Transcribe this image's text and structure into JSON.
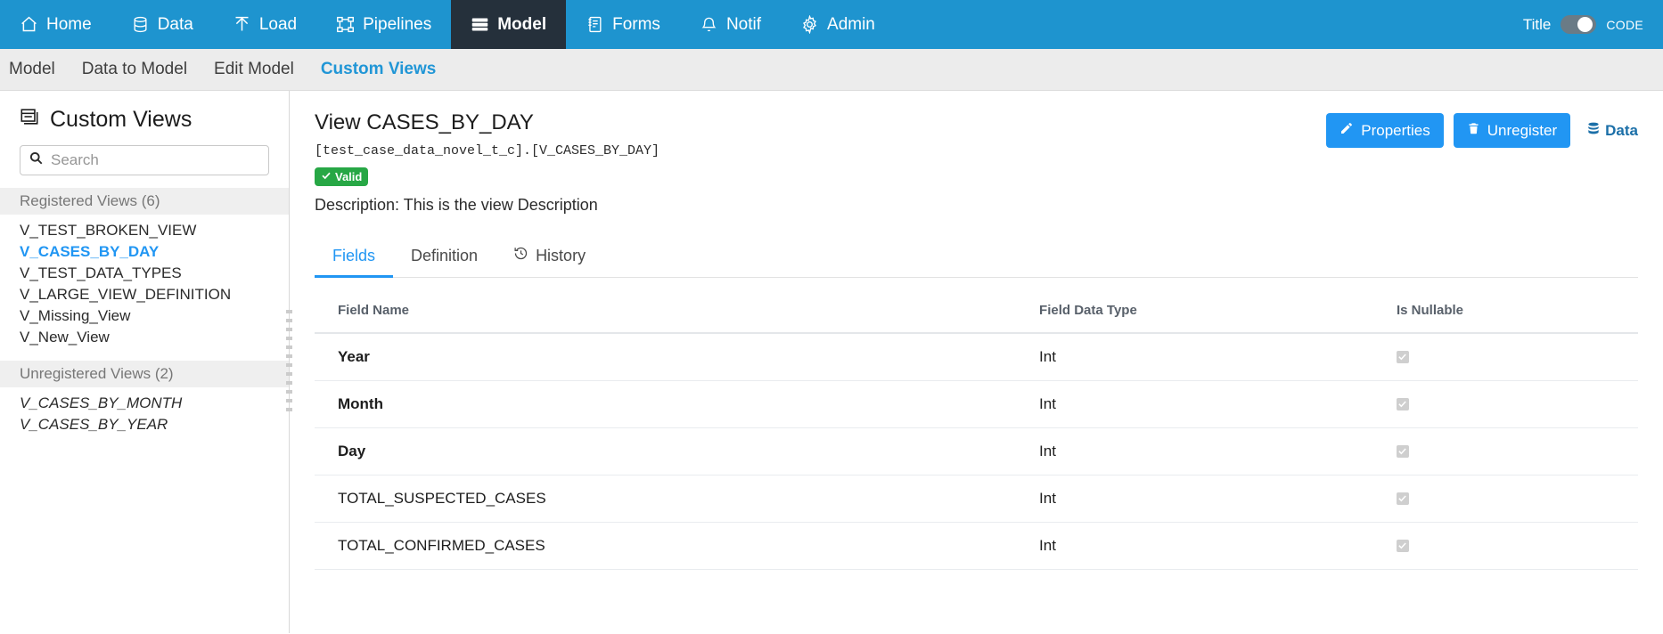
{
  "navbar": {
    "items": [
      {
        "label": "Home",
        "icon": "home-icon",
        "active": false
      },
      {
        "label": "Data",
        "icon": "database-icon",
        "active": false
      },
      {
        "label": "Load",
        "icon": "upload-icon",
        "active": false
      },
      {
        "label": "Pipelines",
        "icon": "pipeline-icon",
        "active": false
      },
      {
        "label": "Model",
        "icon": "server-icon",
        "active": true
      },
      {
        "label": "Forms",
        "icon": "form-icon",
        "active": false
      },
      {
        "label": "Notif",
        "icon": "bell-icon",
        "active": false
      },
      {
        "label": "Admin",
        "icon": "gear-icon",
        "active": false
      }
    ],
    "toggle": {
      "left_label": "Title",
      "right_label": "CODE",
      "state": "right"
    },
    "background_color": "#1e94cf",
    "active_color": "#25303b"
  },
  "breadcrumb": {
    "items": [
      {
        "label": "Model",
        "active": false
      },
      {
        "label": "Data to Model",
        "active": false
      },
      {
        "label": "Edit Model",
        "active": false
      },
      {
        "label": "Custom Views",
        "active": true
      }
    ]
  },
  "sidebar": {
    "title": "Custom Views",
    "title_icon": "window-panel-icon",
    "search": {
      "placeholder": "Search",
      "value": "",
      "icon": "search-icon"
    },
    "groups": [
      {
        "header": "Registered Views (6)",
        "items": [
          {
            "label": "V_TEST_BROKEN_VIEW",
            "selected": false
          },
          {
            "label": "V_CASES_BY_DAY",
            "selected": true
          },
          {
            "label": "V_TEST_DATA_TYPES",
            "selected": false
          },
          {
            "label": "V_LARGE_VIEW_DEFINITION",
            "selected": false
          },
          {
            "label": "V_Missing_View",
            "selected": false
          },
          {
            "label": "V_New_View",
            "selected": false
          }
        ]
      },
      {
        "header": "Unregistered Views (2)",
        "italic": true,
        "items": [
          {
            "label": "V_CASES_BY_MONTH",
            "selected": false
          },
          {
            "label": "V_CASES_BY_YEAR",
            "selected": false
          }
        ]
      }
    ]
  },
  "main": {
    "title": "View CASES_BY_DAY",
    "path": "[test_case_data_novel_t_c].[V_CASES_BY_DAY]",
    "status_badge": {
      "label": "Valid",
      "icon": "check-icon",
      "color": "#27a745"
    },
    "description": "Description: This is the view Description",
    "actions": {
      "properties_label": "Properties",
      "properties_icon": "pencil-icon",
      "unregister_label": "Unregister",
      "unregister_icon": "trash-icon",
      "data_label": "Data",
      "data_icon": "database-icon"
    },
    "tabs": [
      {
        "label": "Fields",
        "icon": null,
        "active": true
      },
      {
        "label": "Definition",
        "icon": null,
        "active": false
      },
      {
        "label": "History",
        "icon": "history-icon",
        "active": false
      }
    ],
    "table": {
      "columns": [
        "Field Name",
        "Field Data Type",
        "Is Nullable"
      ],
      "rows": [
        {
          "name": "Year",
          "type": "Int",
          "nullable": true,
          "bold": true
        },
        {
          "name": "Month",
          "type": "Int",
          "nullable": true,
          "bold": true
        },
        {
          "name": "Day",
          "type": "Int",
          "nullable": true,
          "bold": true
        },
        {
          "name": "TOTAL_SUSPECTED_CASES",
          "type": "Int",
          "nullable": true,
          "bold": false
        },
        {
          "name": "TOTAL_CONFIRMED_CASES",
          "type": "Int",
          "nullable": true,
          "bold": false
        }
      ]
    }
  }
}
